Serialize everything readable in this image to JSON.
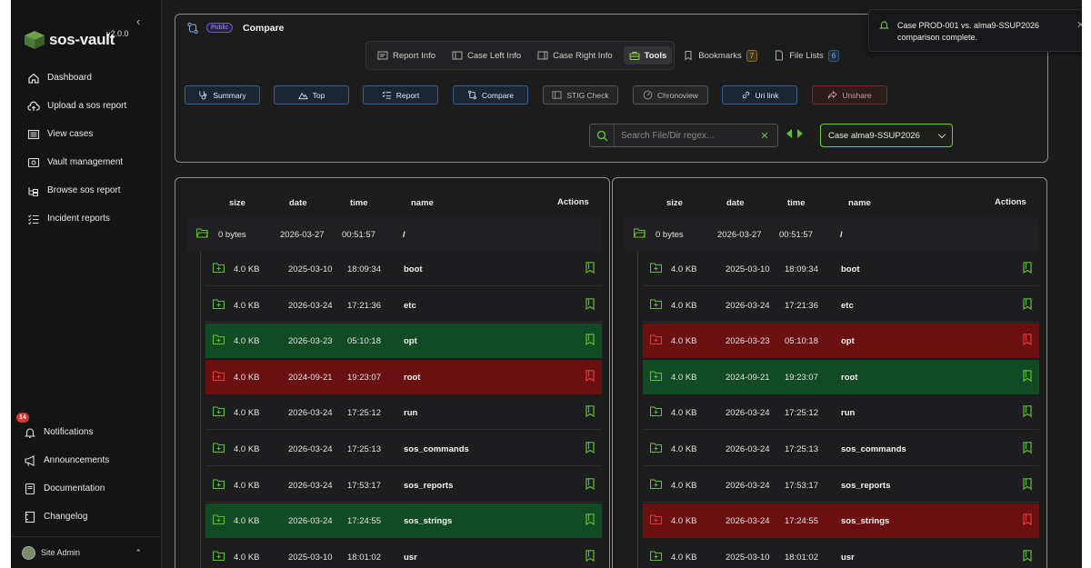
{
  "app": {
    "version": "v2.0.0",
    "logo_text": "sos-vault"
  },
  "sidebar": {
    "items": [
      {
        "label": "Dashboard",
        "icon": "home-icon"
      },
      {
        "label": "Upload a sos report",
        "icon": "cloud-upload-icon"
      },
      {
        "label": "View cases",
        "icon": "list-icon"
      },
      {
        "label": "Vault management",
        "icon": "vault-icon"
      },
      {
        "label": "Browse sos report",
        "icon": "browse-icon"
      },
      {
        "label": "Incident reports",
        "icon": "checklist-icon"
      }
    ],
    "bottom": [
      {
        "label": "Notifications",
        "icon": "bell-icon",
        "badge": "14"
      },
      {
        "label": "Announcements",
        "icon": "megaphone-icon"
      },
      {
        "label": "Documentation",
        "icon": "book-icon"
      },
      {
        "label": "Changelog",
        "icon": "changelog-icon"
      }
    ],
    "user": "Site Admin"
  },
  "header": {
    "badge": "Public",
    "title": "Compare",
    "tabs": [
      {
        "label": "Report Info",
        "active": false
      },
      {
        "label": "Case Left Info",
        "active": false
      },
      {
        "label": "Case Right Info",
        "active": false
      },
      {
        "label": "Tools",
        "active": true
      },
      {
        "label": "Bookmarks",
        "count": "7",
        "active": false
      },
      {
        "label": "File Lists",
        "count": "6",
        "active": false
      }
    ],
    "actions": [
      "Summary",
      "Top",
      "Report",
      "Compare",
      "STIG Check",
      "Chronoview",
      "Uri link",
      "Unshare"
    ],
    "search_placeholder": "Search File/Dir regex...",
    "case_select": "Case alma9-SSUP2026"
  },
  "toast": {
    "message": "Case PROD-001 vs. alma9-SSUP2026 comparison complete."
  },
  "columns": {
    "size": "size",
    "date": "date",
    "time": "time",
    "name": "name",
    "actions": "Actions"
  },
  "colors": {
    "same": "#1d1d1f",
    "newer": "#124a24",
    "older": "#6a1010",
    "accent": "#5fbf32"
  },
  "left": {
    "root": {
      "size": "0 bytes",
      "date": "2026-03-27",
      "time": "00:51:57",
      "name": "/"
    },
    "rows": [
      {
        "size": "4.0 KB",
        "date": "2025-03-10",
        "time": "18:09:34",
        "name": "boot",
        "status": "same"
      },
      {
        "size": "4.0 KB",
        "date": "2026-03-24",
        "time": "17:21:36",
        "name": "etc",
        "status": "same"
      },
      {
        "size": "4.0 KB",
        "date": "2026-03-23",
        "time": "05:10:18",
        "name": "opt",
        "status": "green"
      },
      {
        "size": "4.0 KB",
        "date": "2024-09-21",
        "time": "19:23:07",
        "name": "root",
        "status": "red"
      },
      {
        "size": "4.0 KB",
        "date": "2026-03-24",
        "time": "17:25:12",
        "name": "run",
        "status": "same"
      },
      {
        "size": "4.0 KB",
        "date": "2026-03-24",
        "time": "17:25:13",
        "name": "sos_commands",
        "status": "same"
      },
      {
        "size": "4.0 KB",
        "date": "2026-03-24",
        "time": "17:53:17",
        "name": "sos_reports",
        "status": "same"
      },
      {
        "size": "4.0 KB",
        "date": "2026-03-24",
        "time": "17:24:55",
        "name": "sos_strings",
        "status": "green"
      },
      {
        "size": "4.0 KB",
        "date": "2025-03-10",
        "time": "18:01:02",
        "name": "usr",
        "status": "same"
      }
    ]
  },
  "right": {
    "root": {
      "size": "0 bytes",
      "date": "2026-03-27",
      "time": "00:51:57",
      "name": "/"
    },
    "rows": [
      {
        "size": "4.0 KB",
        "date": "2025-03-10",
        "time": "18:09:34",
        "name": "boot",
        "status": "same"
      },
      {
        "size": "4.0 KB",
        "date": "2026-03-24",
        "time": "17:21:36",
        "name": "etc",
        "status": "same"
      },
      {
        "size": "4.0 KB",
        "date": "2026-03-23",
        "time": "05:10:18",
        "name": "opt",
        "status": "red"
      },
      {
        "size": "4.0 KB",
        "date": "2024-09-21",
        "time": "19:23:07",
        "name": "root",
        "status": "green"
      },
      {
        "size": "4.0 KB",
        "date": "2026-03-24",
        "time": "17:25:12",
        "name": "run",
        "status": "same"
      },
      {
        "size": "4.0 KB",
        "date": "2026-03-24",
        "time": "17:25:13",
        "name": "sos_commands",
        "status": "same"
      },
      {
        "size": "4.0 KB",
        "date": "2026-03-24",
        "time": "17:53:17",
        "name": "sos_reports",
        "status": "same"
      },
      {
        "size": "4.0 KB",
        "date": "2026-03-24",
        "time": "17:24:55",
        "name": "sos_strings",
        "status": "red"
      },
      {
        "size": "4.0 KB",
        "date": "2025-03-10",
        "time": "18:01:02",
        "name": "usr",
        "status": "same"
      }
    ]
  }
}
